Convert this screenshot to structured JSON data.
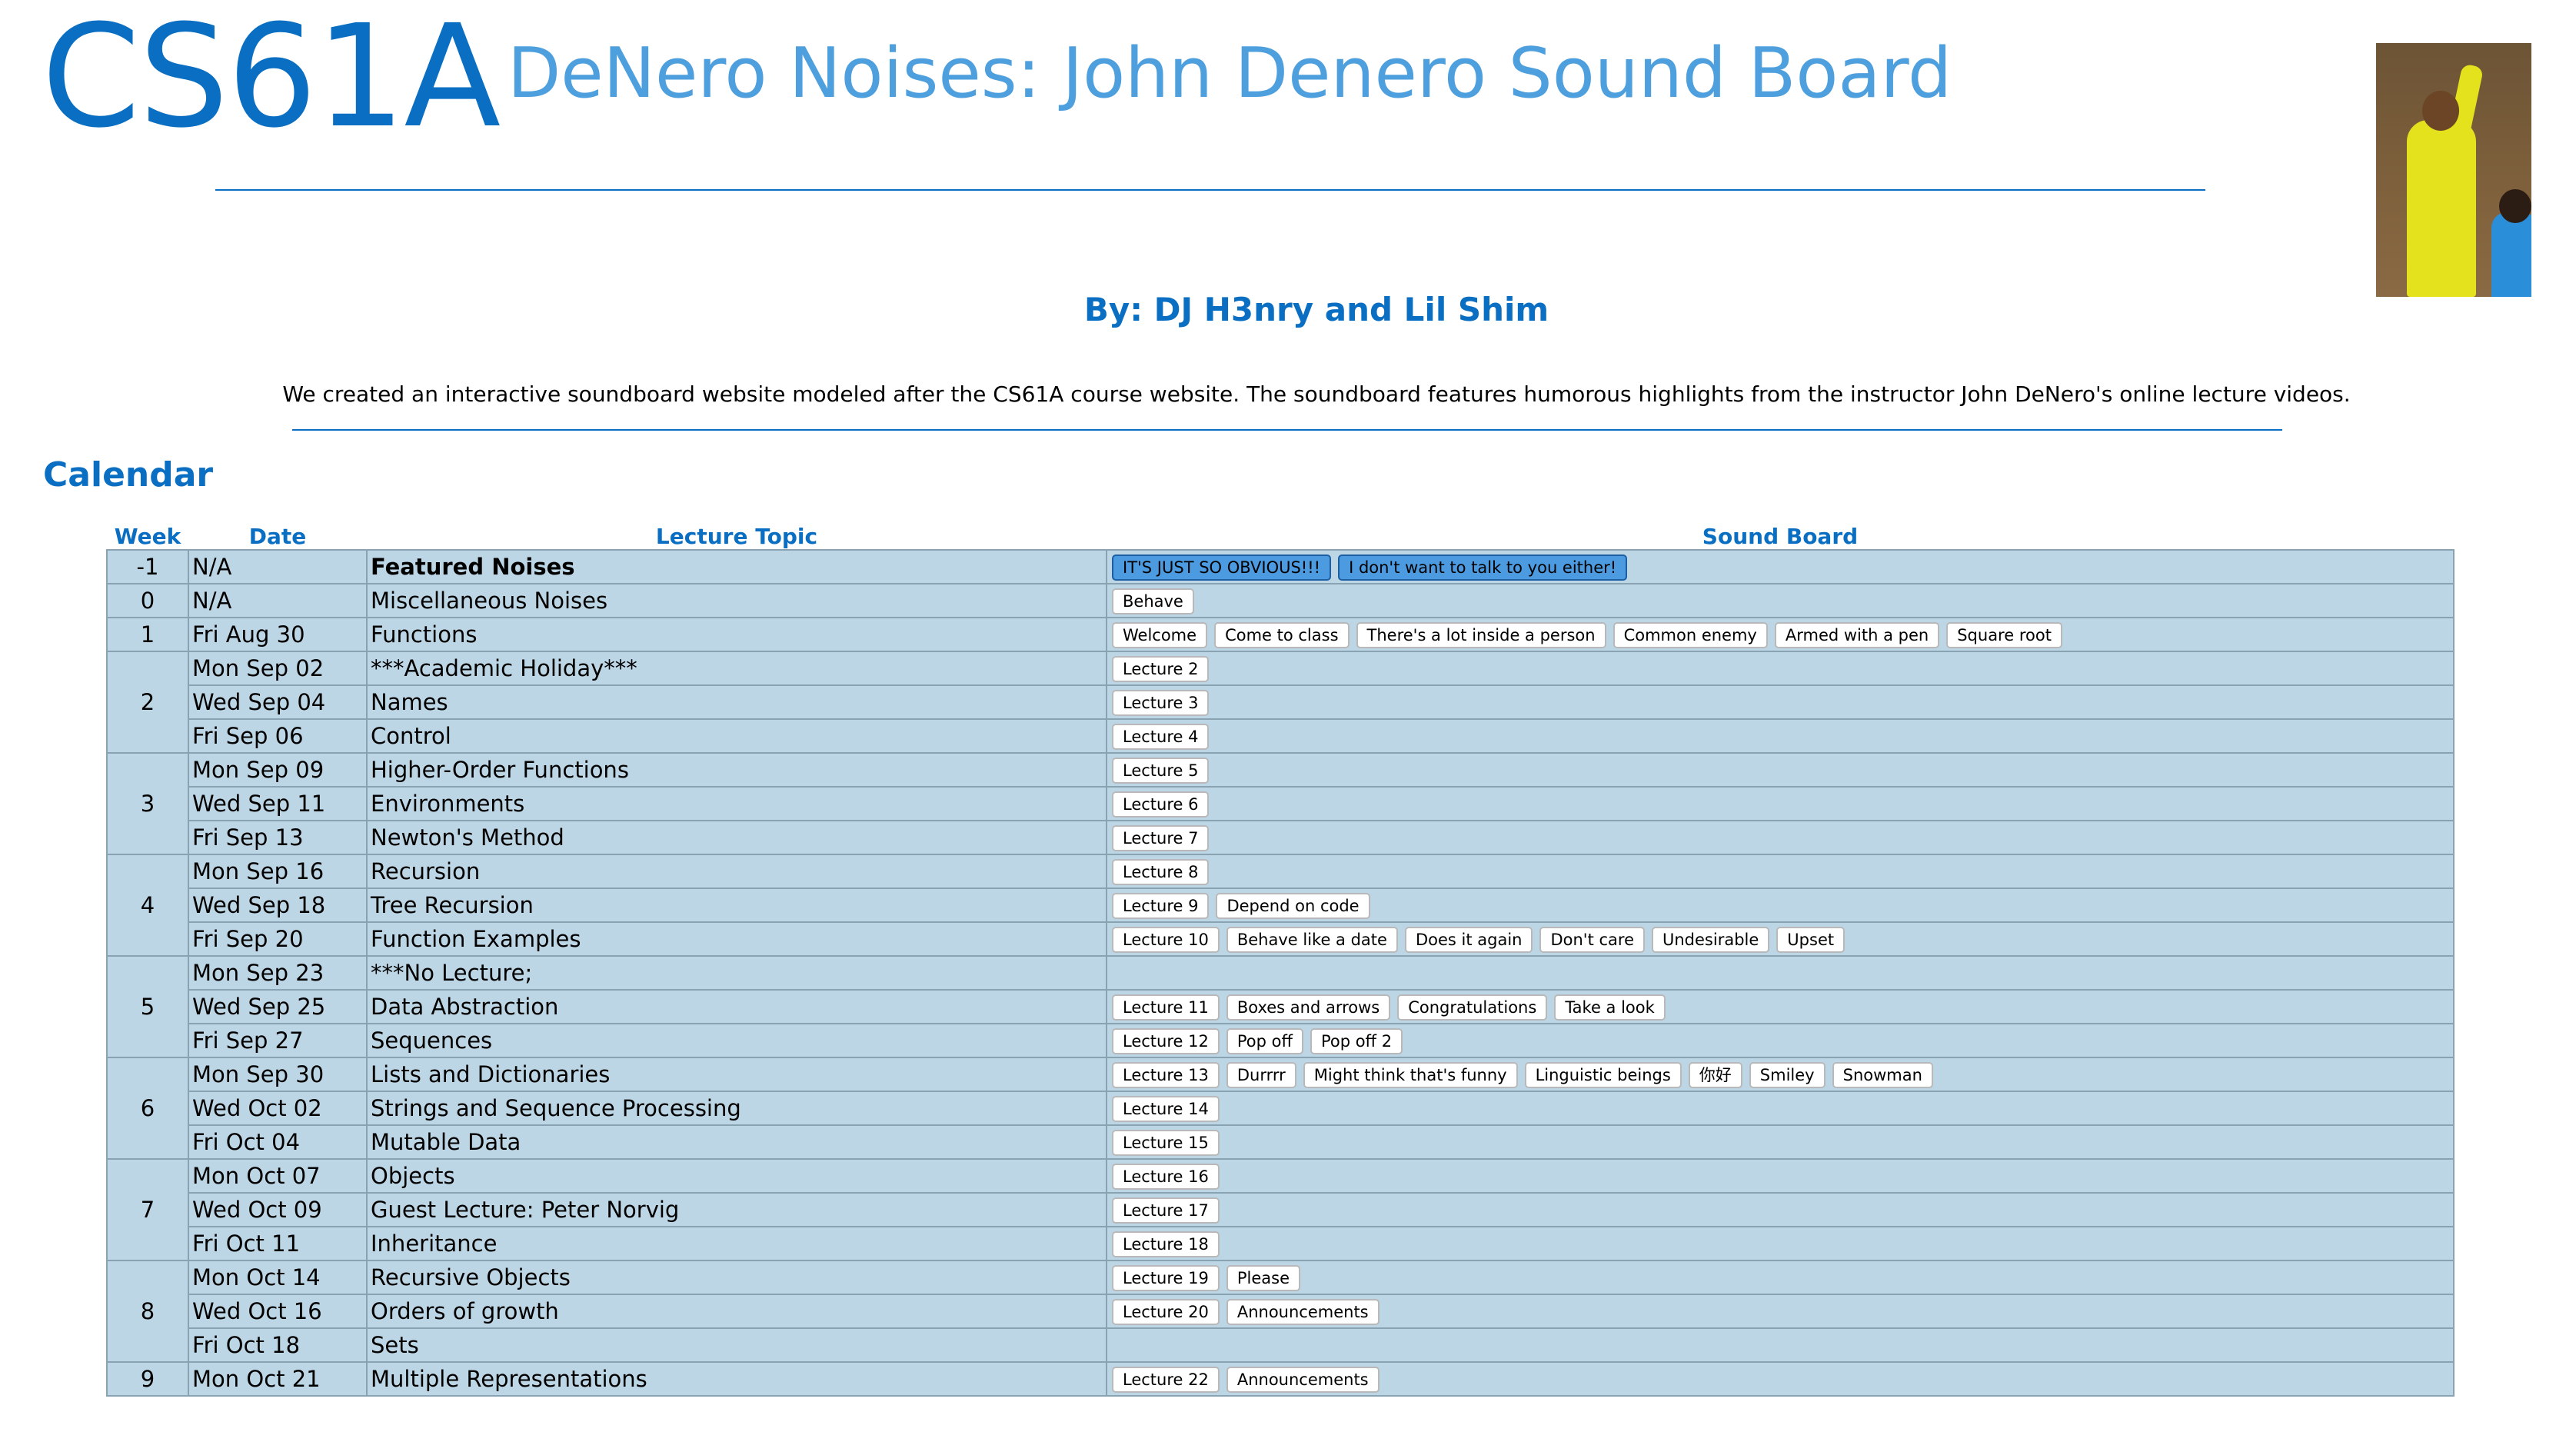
{
  "header": {
    "logo": "CS61A",
    "title": "DeNero Noises: John Denero Sound Board"
  },
  "byline": "By: DJ H3nry and Lil Shim",
  "description": "We created an interactive soundboard website modeled after the CS61A course website. The soundboard features humorous highlights from the instructor John DeNero's online lecture videos.",
  "calendar": {
    "heading": "Calendar",
    "columns": {
      "week": "Week",
      "date": "Date",
      "topic": "Lecture Topic",
      "sound": "Sound Board"
    },
    "weeks": [
      {
        "week": "-1",
        "days": [
          {
            "date": "N/A",
            "topic": "Featured Noises",
            "topic_bold": true,
            "featured": true,
            "buttons": [
              "IT'S JUST SO OBVIOUS!!!",
              "I don't want to talk to you either!"
            ]
          }
        ]
      },
      {
        "week": "0",
        "days": [
          {
            "date": "N/A",
            "topic": "Miscellaneous Noises",
            "buttons": [
              "Behave"
            ]
          }
        ]
      },
      {
        "week": "1",
        "days": [
          {
            "date": "Fri Aug 30",
            "topic": "Functions",
            "buttons": [
              "Welcome",
              "Come to class",
              "There's a lot inside a person",
              "Common enemy",
              "Armed with a pen",
              "Square root"
            ]
          }
        ]
      },
      {
        "week": "2",
        "days": [
          {
            "date": "Mon Sep 02",
            "topic": "***Academic Holiday***",
            "buttons": [
              "Lecture 2"
            ]
          },
          {
            "date": "Wed Sep 04",
            "topic": "Names",
            "buttons": [
              "Lecture 3"
            ]
          },
          {
            "date": "Fri Sep 06",
            "topic": "Control",
            "buttons": [
              "Lecture 4"
            ]
          }
        ]
      },
      {
        "week": "3",
        "days": [
          {
            "date": "Mon Sep 09",
            "topic": "Higher-Order Functions",
            "buttons": [
              "Lecture 5"
            ]
          },
          {
            "date": "Wed Sep 11",
            "topic": "Environments",
            "buttons": [
              "Lecture 6"
            ]
          },
          {
            "date": "Fri Sep 13",
            "topic": "Newton's Method",
            "buttons": [
              "Lecture 7"
            ]
          }
        ]
      },
      {
        "week": "4",
        "days": [
          {
            "date": "Mon Sep 16",
            "topic": "Recursion",
            "buttons": [
              "Lecture 8"
            ]
          },
          {
            "date": "Wed Sep 18",
            "topic": "Tree Recursion",
            "buttons": [
              "Lecture 9",
              "Depend on code"
            ]
          },
          {
            "date": "Fri Sep 20",
            "topic": "Function Examples",
            "buttons": [
              "Lecture 10",
              "Behave like a date",
              "Does it again",
              "Don't care",
              "Undesirable",
              "Upset"
            ]
          }
        ]
      },
      {
        "week": "5",
        "days": [
          {
            "date": "Mon Sep 23",
            "topic": "***No Lecture;",
            "buttons": []
          },
          {
            "date": "Wed Sep 25",
            "topic": "Data Abstraction",
            "buttons": [
              "Lecture 11",
              "Boxes and arrows",
              "Congratulations",
              "Take a look"
            ]
          },
          {
            "date": "Fri Sep 27",
            "topic": "Sequences",
            "buttons": [
              "Lecture 12",
              "Pop off",
              "Pop off 2"
            ]
          }
        ]
      },
      {
        "week": "6",
        "days": [
          {
            "date": "Mon Sep 30",
            "topic": "Lists and Dictionaries",
            "buttons": [
              "Lecture 13",
              "Durrrr",
              "Might think that's funny",
              "Linguistic beings",
              "你好",
              "Smiley",
              "Snowman"
            ]
          },
          {
            "date": "Wed Oct 02",
            "topic": "Strings and Sequence Processing",
            "buttons": [
              "Lecture 14"
            ]
          },
          {
            "date": "Fri Oct 04",
            "topic": "Mutable Data",
            "buttons": [
              "Lecture 15"
            ]
          }
        ]
      },
      {
        "week": "7",
        "days": [
          {
            "date": "Mon Oct 07",
            "topic": "Objects",
            "buttons": [
              "Lecture 16"
            ]
          },
          {
            "date": "Wed Oct 09",
            "topic": "Guest Lecture: Peter Norvig",
            "buttons": [
              "Lecture 17"
            ]
          },
          {
            "date": "Fri Oct 11",
            "topic": "Inheritance",
            "buttons": [
              "Lecture 18"
            ]
          }
        ]
      },
      {
        "week": "8",
        "days": [
          {
            "date": "Mon Oct 14",
            "topic": "Recursive Objects",
            "buttons": [
              "Lecture 19",
              "Please"
            ]
          },
          {
            "date": "Wed Oct 16",
            "topic": "Orders of growth",
            "buttons": [
              "Lecture 20",
              "Announcements"
            ]
          },
          {
            "date": "Fri Oct 18",
            "topic": "Sets",
            "buttons": []
          }
        ]
      },
      {
        "week": "9",
        "days": [
          {
            "date": "Mon Oct 21",
            "topic": "Multiple Representations",
            "buttons": [
              "Lecture 22",
              "Announcements"
            ]
          }
        ]
      }
    ]
  },
  "colors": {
    "brand_blue": "#0a6fc2",
    "title_blue": "#4e9fdd",
    "table_cell": "#bdd6e6",
    "featured_button": "#4c9be0"
  }
}
